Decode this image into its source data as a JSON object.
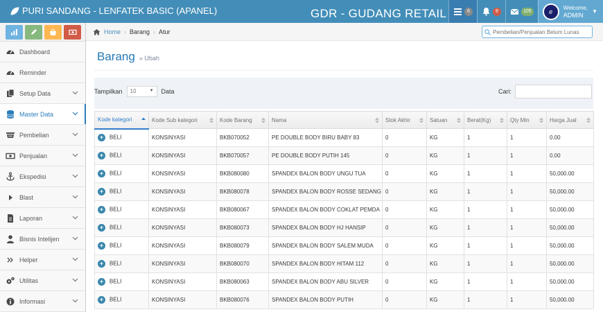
{
  "app": {
    "title": "PURI SANDANG - LENFATEK BASIC (APANEL)",
    "store_name": "GDR - GUDANG RETAIL",
    "accent_color": "#438eb9"
  },
  "navbar": {
    "tasks_count": "6",
    "notifications_count": "8",
    "messages_count": "105",
    "welcome_text": "Welcome,",
    "user_name": "ADMIN"
  },
  "sidebar": {
    "shortcuts": [
      {
        "icon": "signal-icon",
        "color": "#6fb3e0"
      },
      {
        "icon": "pencil-icon",
        "color": "#87b87f"
      },
      {
        "icon": "basket-icon",
        "color": "#ffb752"
      },
      {
        "icon": "money-icon",
        "color": "#d15b47"
      }
    ],
    "items": [
      {
        "label": "Dashboard",
        "icon": "tachometer-icon",
        "has_submenu": false
      },
      {
        "label": "Reminder",
        "icon": "tachometer-icon",
        "has_submenu": false
      },
      {
        "label": "Setup Data",
        "icon": "file-icon",
        "has_submenu": true
      },
      {
        "label": "Master Data",
        "icon": "database-icon",
        "has_submenu": true,
        "active": true
      },
      {
        "label": "Pembelian",
        "icon": "cart-icon",
        "has_submenu": true
      },
      {
        "label": "Penjualan",
        "icon": "money-icon",
        "has_submenu": true
      },
      {
        "label": "Ekspedisi",
        "icon": "anchor-icon",
        "has_submenu": true
      },
      {
        "label": "Blast",
        "icon": "caret-right-icon",
        "has_submenu": true
      },
      {
        "label": "Laporan",
        "icon": "document-icon",
        "has_submenu": true
      },
      {
        "label": "Bisnis Intelijen",
        "icon": "user-icon",
        "has_submenu": true
      },
      {
        "label": "Helper",
        "icon": "double-angle-icon",
        "has_submenu": true
      },
      {
        "label": "Utilitas",
        "icon": "cogs-icon",
        "has_submenu": true
      },
      {
        "label": "Informasi",
        "icon": "info-icon",
        "has_submenu": true
      }
    ]
  },
  "breadcrumb": {
    "home": "Home",
    "level1": "Barang",
    "level2": "Atur"
  },
  "search": {
    "placeholder": "Pembelian/Penjualan Belum Lunas"
  },
  "page": {
    "title": "Barang",
    "subtitle": "Ubah"
  },
  "table_controls": {
    "show_label": "Tampilkan",
    "show_value": "10",
    "entries_label": "Data",
    "search_label": "Cari:"
  },
  "table": {
    "columns": [
      "Kode kategori",
      "Kode Sub kategori",
      "Kode Barang",
      "Nama",
      "Stok Akhir",
      "Satuan",
      "Berat(Kg)",
      "Qty Min",
      "Harga Jual"
    ],
    "rows": [
      [
        "BELI",
        "KONSINYASI",
        "BKB070052",
        "PE DOUBLE BODY BIRU BABY 83",
        "0",
        "KG",
        "1",
        "1",
        "0.00"
      ],
      [
        "BELI",
        "KONSINYASI",
        "BKB070057",
        "PE DOUBLE BODY PUTIH 145",
        "0",
        "KG",
        "1",
        "1",
        "0.00"
      ],
      [
        "BELI",
        "KONSINYASI",
        "BKB080080",
        "SPANDEX BALON BODY UNGU TUA",
        "0",
        "KG",
        "1",
        "1",
        "50,000.00"
      ],
      [
        "BELI",
        "KONSINYASI",
        "BKB080078",
        "SPANDEX BALON BODY ROSSE SEDANG",
        "0",
        "KG",
        "1",
        "1",
        "50,000.00"
      ],
      [
        "BELI",
        "KONSINYASI",
        "BKB080067",
        "SPANDEX BALON BODY COKLAT PEMDA",
        "0",
        "KG",
        "1",
        "1",
        "50,000.00"
      ],
      [
        "BELI",
        "KONSINYASI",
        "BKB080073",
        "SPANDEX BALON BODY HJ HANSIP",
        "0",
        "KG",
        "1",
        "1",
        "50,000.00"
      ],
      [
        "BELI",
        "KONSINYASI",
        "BKB080079",
        "SPANDEX BALON BODY SALEM MUDA",
        "0",
        "KG",
        "1",
        "1",
        "50,000.00"
      ],
      [
        "BELI",
        "KONSINYASI",
        "BKB080070",
        "SPANDEX BALON BODY HITAM 112",
        "0",
        "KG",
        "1",
        "1",
        "50,000.00"
      ],
      [
        "BELI",
        "KONSINYASI",
        "BKB080063",
        "SPANDEX BALON BODY ABU SILVER",
        "0",
        "KG",
        "1",
        "1",
        "50,000.00"
      ],
      [
        "BELI",
        "KONSINYASI",
        "BKB080076",
        "SPANDEX BALON BODY PUTIH",
        "0",
        "KG",
        "1",
        "1",
        "50,000.00"
      ]
    ]
  }
}
